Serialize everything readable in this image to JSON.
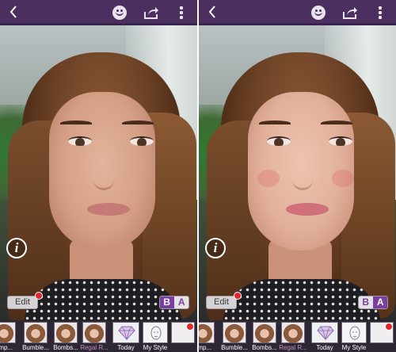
{
  "panels": [
    {
      "id": "before",
      "edit_label": "Edit",
      "toggle": {
        "b": "B",
        "a": "A",
        "selected": "B"
      },
      "strip": [
        {
          "label": "amp...",
          "kind": "face"
        },
        {
          "label": "Bumble...",
          "kind": "face"
        },
        {
          "label": "Bombs...",
          "kind": "face"
        },
        {
          "label": "Regal R...",
          "kind": "face",
          "active": true
        },
        {
          "label": "Today",
          "kind": "gem"
        },
        {
          "label": "My Style",
          "kind": "style"
        },
        {
          "label": "",
          "kind": "partial",
          "badge": true
        }
      ]
    },
    {
      "id": "after",
      "edit_label": "Edit",
      "toggle": {
        "b": "B",
        "a": "A",
        "selected": "A"
      },
      "strip": [
        {
          "label": "amp...",
          "kind": "face"
        },
        {
          "label": "Bumble...",
          "kind": "face"
        },
        {
          "label": "Bombs...",
          "kind": "face"
        },
        {
          "label": "Regal R...",
          "kind": "face",
          "active": true
        },
        {
          "label": "Today",
          "kind": "gem"
        },
        {
          "label": "My Style",
          "kind": "style"
        },
        {
          "label": "",
          "kind": "partial",
          "badge": true
        }
      ]
    }
  ],
  "icons": {
    "back": "chevron-left-icon",
    "emoji": "smiley-icon",
    "share": "share-icon",
    "menu": "overflow-menu-icon",
    "info": "info-icon",
    "badge": "notification-dot-icon",
    "today": "diamond-icon"
  },
  "info_glyph": "i",
  "colors": {
    "topbar": "#4a2f5f",
    "accent": "#7a3fa0",
    "badge": "#e0282c",
    "active_label": "#c48ec4"
  }
}
